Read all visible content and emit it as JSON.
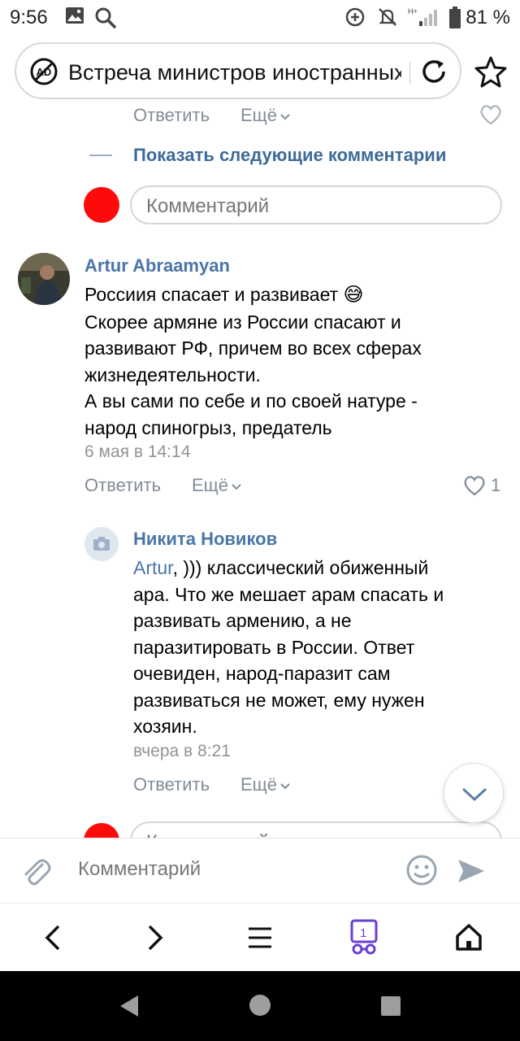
{
  "status_bar": {
    "time": "9:56",
    "battery": "81 %",
    "network": "H+"
  },
  "address_bar": {
    "title": "Встреча министров иностранных дел"
  },
  "comments": {
    "prev_actions": {
      "reply": "Ответить",
      "more": "Ещё"
    },
    "show_next": "Показать следующие комментарии",
    "input_placeholder": "Комментарий",
    "main": {
      "author": "Artur Abraamyan",
      "lines": [
        "Россиия спасает и развивает",
        "Скорее армяне из России спасают и",
        "развивают РФ, причем во всех сферах",
        "жизнедеятельности.",
        "А вы сами по себе и по своей натуре -",
        "народ спиногрыз, предатель"
      ],
      "emoji": "😅",
      "date": "6 мая в 14:14",
      "reply": "Ответить",
      "more": "Ещё",
      "likes": "1"
    },
    "reply": {
      "author": "Никита Новиков",
      "mention": "Artur",
      "first_line_rest": ", ))) классический обиженный",
      "lines": [
        "ара. Что же мешает арам спасать и",
        "развивать армению, а не",
        "паразитировать в России. Ответ",
        "очевиден, народ-паразит сам",
        "развиваться не может, ему нужен",
        "хозяин."
      ],
      "date": "вчера в 8:21",
      "reply": "Ответить",
      "more": "Ещё"
    },
    "bottom_partial_placeholder": "Комментарий"
  },
  "comment_bar": {
    "placeholder": "Комментарий"
  },
  "browser_nav": {
    "tabs_count": "1"
  },
  "colors": {
    "accent": "#4a76a8",
    "red_avatar": "#ff0a0a",
    "tab_purple": "#6a3fd1"
  },
  "icons": [
    "picture-icon",
    "search-icon",
    "data-saver-icon",
    "mute-icon",
    "signal-icon",
    "battery-icon",
    "adblock-icon",
    "reload-icon",
    "star-icon",
    "heart-icon",
    "chevron-down-icon",
    "camera-icon",
    "attach-icon",
    "emoji-icon",
    "send-icon",
    "back-icon",
    "forward-icon",
    "menu-icon",
    "tabs-icon",
    "home-icon"
  ]
}
